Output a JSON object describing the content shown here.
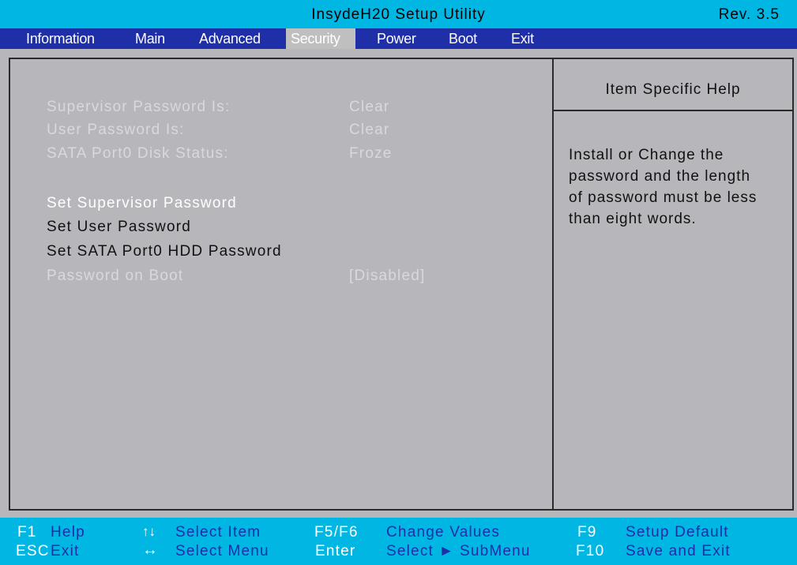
{
  "title": "InsydeH20 Setup Utility",
  "revision": "Rev. 3.5",
  "menu": {
    "items": [
      "Information",
      "Main",
      "Advanced",
      "Security",
      "Power",
      "Boot",
      "Exit"
    ],
    "active": "Security"
  },
  "content": {
    "status": [
      {
        "label": "Supervisor Password Is:",
        "value": "Clear"
      },
      {
        "label": "User Password Is:",
        "value": "Clear"
      },
      {
        "label": "SATA Port0 Disk Status:",
        "value": "Froze"
      }
    ],
    "actions": [
      {
        "label": "Set Supervisor Password",
        "state": "selected"
      },
      {
        "label": "Set User Password",
        "state": "normal"
      },
      {
        "label": "Set SATA Port0 HDD Password",
        "state": "normal"
      }
    ],
    "password_on_boot": {
      "label": "Password on Boot",
      "value": "[Disabled]"
    }
  },
  "help": {
    "title": "Item Specific Help",
    "lines": [
      "Install or Change the",
      "password and the length",
      "of password must be less",
      "than eight words."
    ]
  },
  "footer": {
    "f1_key": "F1",
    "f1_desc": "Help",
    "esc_key": "ESC",
    "esc_desc": "Exit",
    "updown_key": "↑↓",
    "updown_desc": "Select  Item",
    "leftright_key": "↔",
    "leftright_desc": "Select  Menu",
    "f5f6_key": "F5/F6",
    "f5f6_desc": "Change  Values",
    "enter_key": "Enter",
    "enter_desc": "Select  ► SubMenu",
    "f9_key": "F9",
    "f9_desc": "Setup  Default",
    "f10_key": "F10",
    "f10_desc": "Save  and  Exit"
  },
  "colors": {
    "title_bar": "#00b6e3",
    "menu_bar": "#1e2fa8",
    "panel": "#b7b7bb",
    "active_tab": "#bfbfbf"
  }
}
